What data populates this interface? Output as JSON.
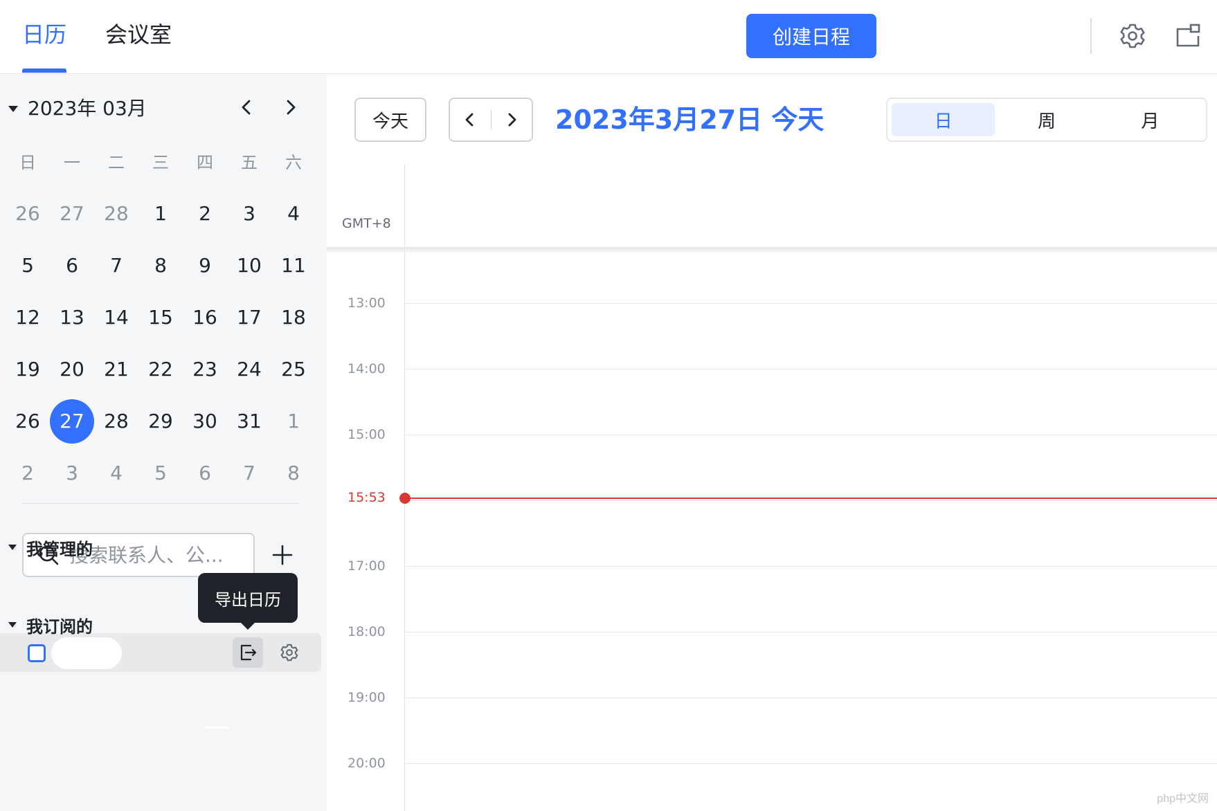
{
  "topbar": {
    "tabs": [
      {
        "label": "日历",
        "active": true
      },
      {
        "label": "会议室",
        "active": false
      }
    ],
    "create_button": "创建日程",
    "icons": [
      "gear-icon",
      "window-icon"
    ]
  },
  "sidebar": {
    "month_title": "2023年 03月",
    "weekdays": [
      "日",
      "一",
      "二",
      "三",
      "四",
      "五",
      "六"
    ],
    "days": [
      {
        "d": "26",
        "muted": true
      },
      {
        "d": "27",
        "muted": true
      },
      {
        "d": "28",
        "muted": true
      },
      {
        "d": "1"
      },
      {
        "d": "2"
      },
      {
        "d": "3"
      },
      {
        "d": "4"
      },
      {
        "d": "5"
      },
      {
        "d": "6"
      },
      {
        "d": "7"
      },
      {
        "d": "8"
      },
      {
        "d": "9"
      },
      {
        "d": "10"
      },
      {
        "d": "11"
      },
      {
        "d": "12"
      },
      {
        "d": "13"
      },
      {
        "d": "14"
      },
      {
        "d": "15"
      },
      {
        "d": "16"
      },
      {
        "d": "17"
      },
      {
        "d": "18"
      },
      {
        "d": "19"
      },
      {
        "d": "20"
      },
      {
        "d": "21"
      },
      {
        "d": "22"
      },
      {
        "d": "23"
      },
      {
        "d": "24"
      },
      {
        "d": "25"
      },
      {
        "d": "26"
      },
      {
        "d": "27",
        "today": true
      },
      {
        "d": "28"
      },
      {
        "d": "29"
      },
      {
        "d": "30"
      },
      {
        "d": "31"
      },
      {
        "d": "1",
        "muted": true
      },
      {
        "d": "2",
        "muted": true
      },
      {
        "d": "3",
        "muted": true
      },
      {
        "d": "4",
        "muted": true
      },
      {
        "d": "5",
        "muted": true
      },
      {
        "d": "6",
        "muted": true
      },
      {
        "d": "7",
        "muted": true
      },
      {
        "d": "8",
        "muted": true
      }
    ],
    "search_placeholder": "搜索联系人、公...",
    "groups": {
      "managed": "我管理的",
      "subscribed": "我订阅的"
    },
    "tooltip": "导出日历"
  },
  "main": {
    "today_button": "今天",
    "date_title": "2023年3月27日 今天",
    "views": [
      {
        "label": "日",
        "active": true
      },
      {
        "label": "周",
        "active": false
      },
      {
        "label": "月",
        "active": false
      }
    ],
    "timezone": "GMT+8",
    "hours": [
      "13:00",
      "14:00",
      "15:00",
      "17:00",
      "18:00",
      "19:00",
      "20:00"
    ],
    "now_time": "15:53"
  },
  "watermark": "php中文网",
  "colors": {
    "accent": "#3370ff",
    "now_line": "#d83931",
    "sidebar_bg": "#f5f6f7"
  }
}
